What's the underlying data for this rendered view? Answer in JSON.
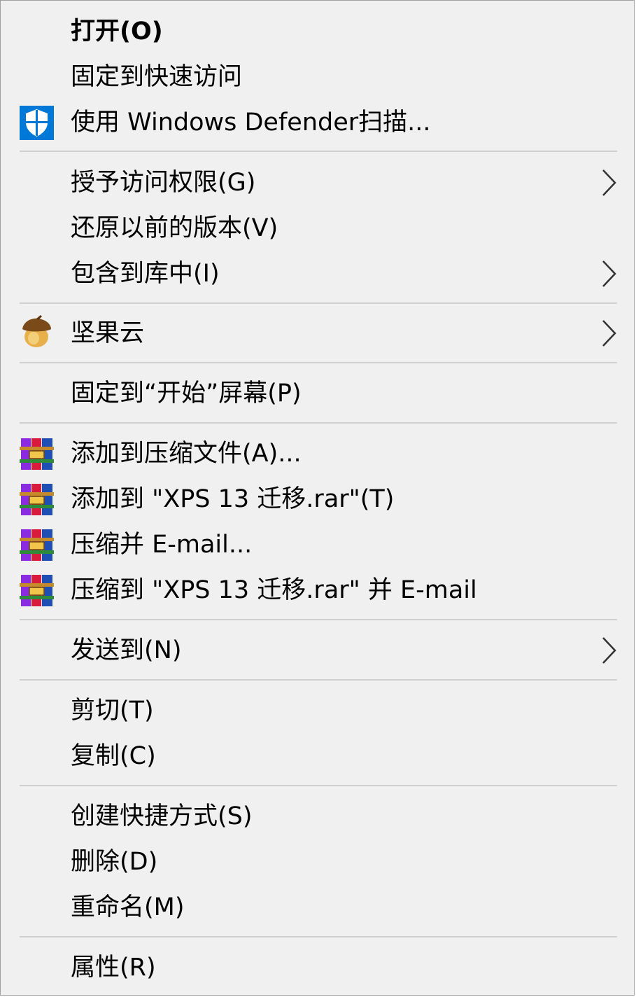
{
  "menu": {
    "open": "打开(O)",
    "pin_quick_access": "固定到快速访问",
    "defender_scan": "使用 Windows Defender扫描...",
    "grant_access": "授予访问权限(G)",
    "restore_versions": "还原以前的版本(V)",
    "include_library": "包含到库中(I)",
    "jianguoyun": "坚果云",
    "pin_start": "固定到“开始”屏幕(P)",
    "add_archive": "添加到压缩文件(A)...",
    "add_to_rar": "添加到 \"XPS 13 迁移.rar\"(T)",
    "compress_email": "压缩并 E-mail...",
    "compress_to_rar_email": "压缩到 \"XPS 13 迁移.rar\" 并 E-mail",
    "send_to": "发送到(N)",
    "cut": "剪切(T)",
    "copy": "复制(C)",
    "create_shortcut": "创建快捷方式(S)",
    "delete": "删除(D)",
    "rename": "重命名(M)",
    "properties": "属性(R)"
  },
  "icons": {
    "defender": "shield-icon",
    "jianguoyun": "acorn-icon",
    "winrar": "winrar-books-icon",
    "submenu": "chevron-right-icon"
  },
  "colors": {
    "menu_background": "#f0f0f0",
    "separator": "#d0d0d0",
    "shield_blue": "#0078d7"
  }
}
